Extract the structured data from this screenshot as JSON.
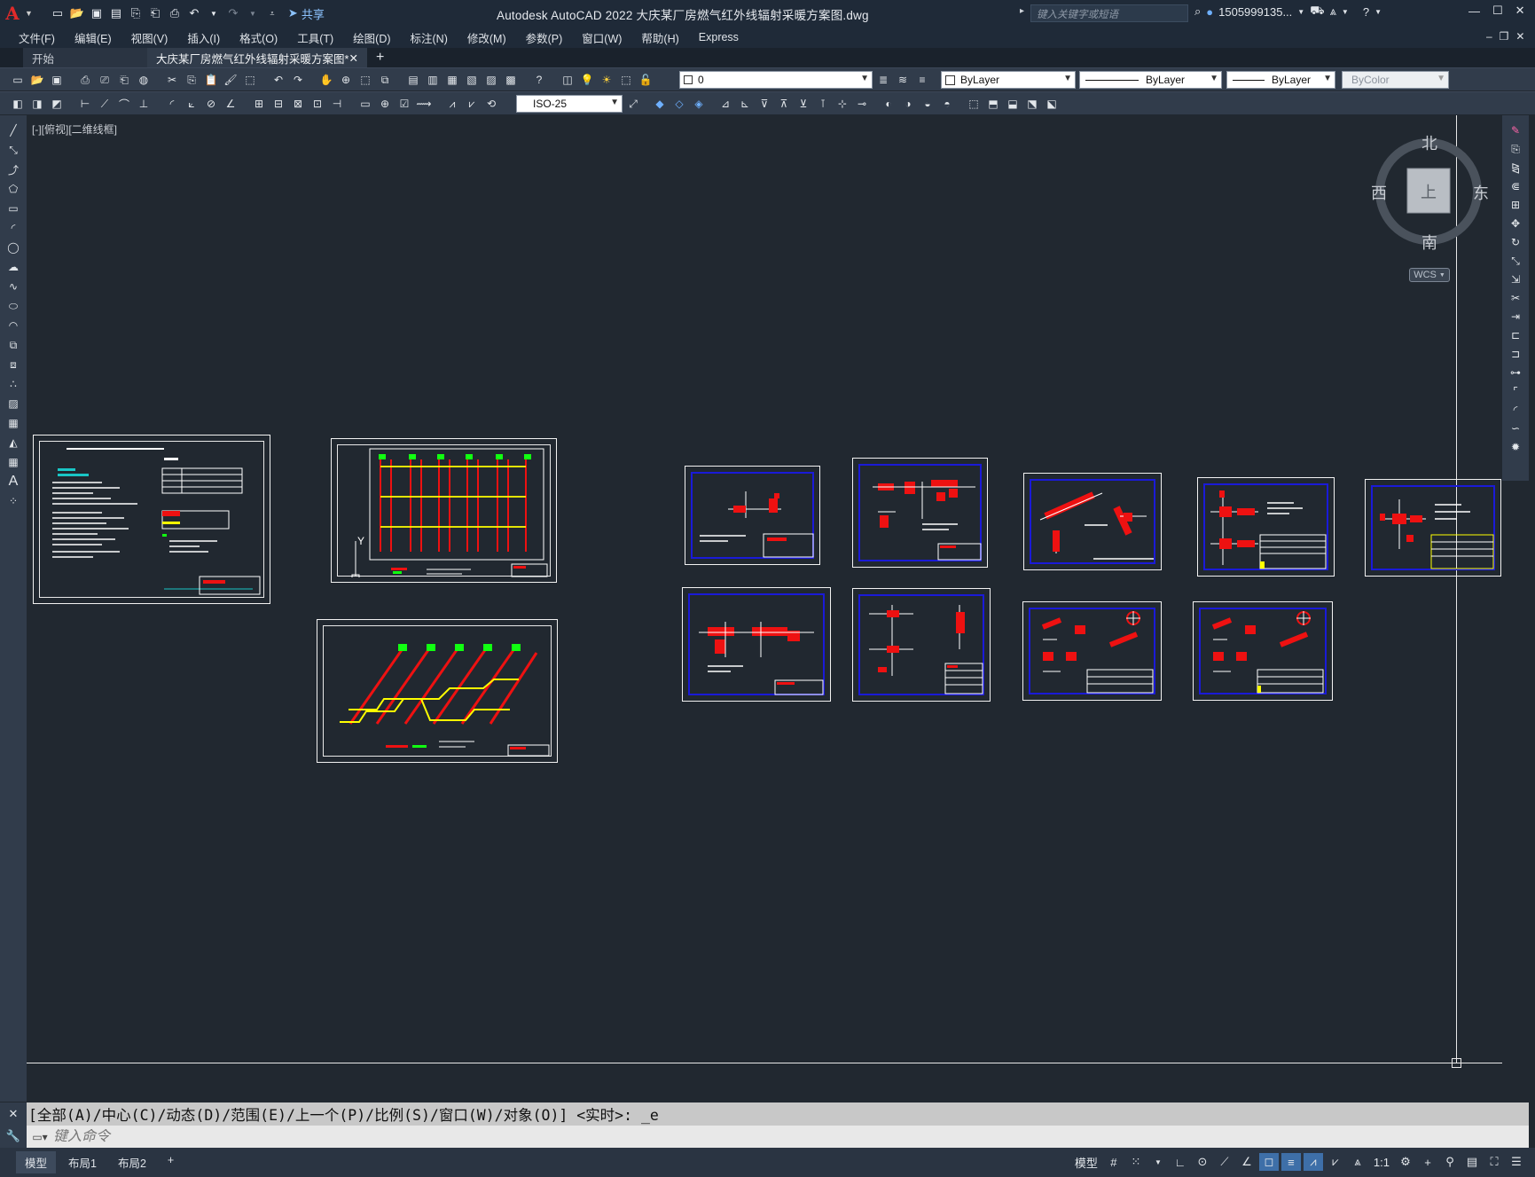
{
  "app": {
    "title": "Autodesk AutoCAD 2022    大庆某厂房燃气红外线辐射采暖方案图.dwg",
    "logo": "A",
    "share": "共享"
  },
  "search": {
    "placeholder": "键入关键字或短语"
  },
  "user": {
    "name": "1505999135..."
  },
  "menu": [
    "文件(F)",
    "编辑(E)",
    "视图(V)",
    "插入(I)",
    "格式(O)",
    "工具(T)",
    "绘图(D)",
    "标注(N)",
    "修改(M)",
    "参数(P)",
    "窗口(W)",
    "帮助(H)",
    "Express"
  ],
  "file_tabs": [
    {
      "label": "开始",
      "active": false
    },
    {
      "label": "大庆某厂房燃气红外线辐射采暖方案图*",
      "active": true
    }
  ],
  "toolbar": {
    "layer": "0",
    "color": "ByLayer",
    "linetype": "ByLayer",
    "lineweight": "ByLayer",
    "plotstyle": "ByColor",
    "dimstyle": "ISO-25"
  },
  "viewport": {
    "label": "[-][俯视][二维线框]"
  },
  "viewcube": {
    "north": "北",
    "south": "南",
    "east": "东",
    "west": "西",
    "top": "上",
    "wcs": "WCS"
  },
  "command": {
    "history": "[全部(A)/中心(C)/动态(D)/范围(E)/上一个(P)/比例(S)/窗口(W)/对象(O)] <实时>: _e",
    "placeholder": "键入命令"
  },
  "layout_tabs": [
    {
      "label": "模型",
      "active": true
    },
    {
      "label": "布局1",
      "active": false
    },
    {
      "label": "布局2",
      "active": false
    }
  ],
  "status": {
    "model": "模型",
    "scale": "1:1"
  },
  "colors": {
    "accent": "#e12a2a",
    "canvas": "#212830",
    "toolbar": "#313c4b"
  },
  "drawing_sheets": [
    "design-notes",
    "floor-plan",
    "isometric",
    "detail-1",
    "detail-2",
    "detail-3",
    "detail-4",
    "detail-5",
    "detail-6",
    "detail-7",
    "detail-8",
    "detail-9"
  ]
}
